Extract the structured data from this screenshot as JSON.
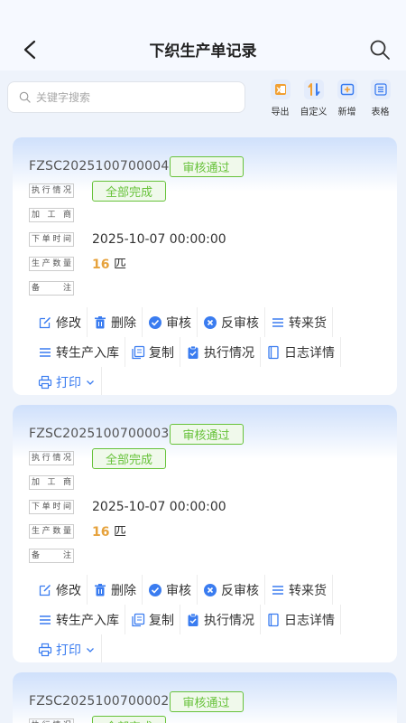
{
  "header": {
    "title": "下织生产单记录"
  },
  "search": {
    "placeholder": "关键字搜索"
  },
  "toolbar": [
    {
      "id": "export",
      "label": "导出",
      "icon": "excel-export-icon"
    },
    {
      "id": "custom",
      "label": "自定义",
      "icon": "sort-icon"
    },
    {
      "id": "add",
      "label": "新增",
      "icon": "add-box-icon"
    },
    {
      "id": "table",
      "label": "表格",
      "icon": "list-icon"
    }
  ],
  "labels": {
    "exec": "执行情况",
    "processor": "加工商",
    "order_time": "下单时间",
    "quantity": "生产数量",
    "remark": "备注"
  },
  "actions": {
    "edit": "修改",
    "delete": "删除",
    "audit": "审核",
    "unaudit": "反审核",
    "to_incoming": "转来货",
    "to_stock": "转生产入库",
    "copy": "复制",
    "exec": "执行情况",
    "log": "日志详情",
    "print": "打印"
  },
  "records": [
    {
      "code": "FZSC2025100700004",
      "status": "审核通过",
      "exec": "全部完成",
      "processor": "",
      "order_time": "2025-10-07 00:00:00",
      "qty": "16",
      "unit": "匹",
      "remark": ""
    },
    {
      "code": "FZSC2025100700003",
      "status": "审核通过",
      "exec": "全部完成",
      "processor": "",
      "order_time": "2025-10-07 00:00:00",
      "qty": "16",
      "unit": "匹",
      "remark": ""
    },
    {
      "code": "FZSC2025100700002",
      "status": "审核通过",
      "exec": "全部完成",
      "processor": "",
      "order_time": "",
      "qty": "",
      "unit": "",
      "remark": ""
    }
  ],
  "colors": {
    "accent": "#3a7cf0",
    "success": "#67c23a",
    "qty": "#e6a23c"
  }
}
